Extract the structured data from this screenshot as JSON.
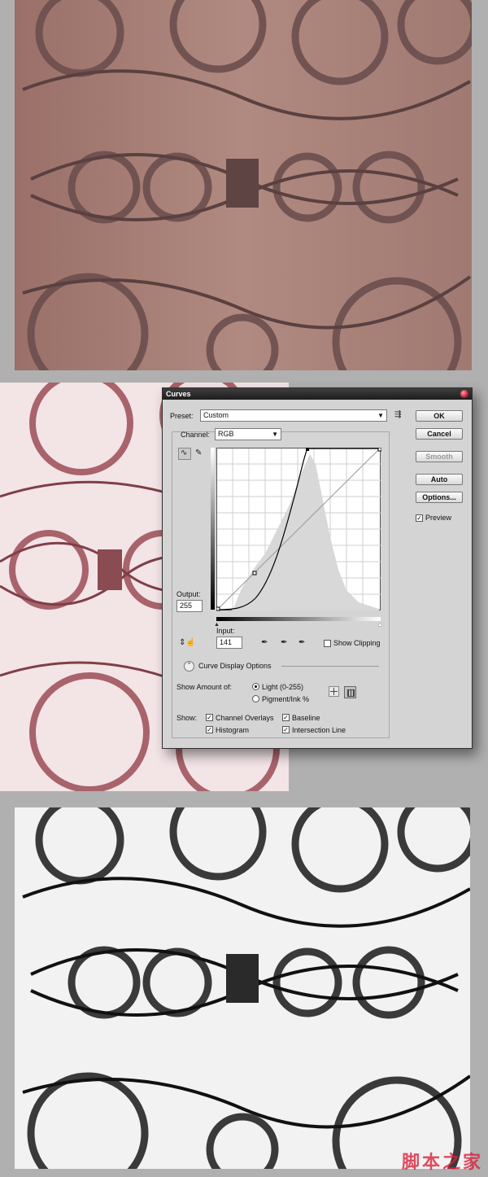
{
  "dialog": {
    "title": "Curves",
    "preset_label": "Preset:",
    "preset_value": "Custom",
    "channel_label": "Channel:",
    "channel_value": "RGB",
    "output_label": "Output:",
    "output_value": "255",
    "input_label": "Input:",
    "input_value": "141",
    "show_clipping_label": "Show Clipping",
    "curve_display_options_label": "Curve Display Options",
    "show_amount_label": "Show Amount of:",
    "light_label": "Light  (0-255)",
    "pigment_label": "Pigment/Ink %",
    "show_label": "Show:",
    "channel_overlays_label": "Channel Overlays",
    "baseline_label": "Baseline",
    "histogram_label": "Histogram",
    "intersection_line_label": "Intersection Line",
    "preview_label": "Preview",
    "buttons": {
      "ok": "OK",
      "cancel": "Cancel",
      "smooth": "Smooth",
      "auto": "Auto",
      "options": "Options..."
    }
  },
  "watermark_text": "脚本之家"
}
